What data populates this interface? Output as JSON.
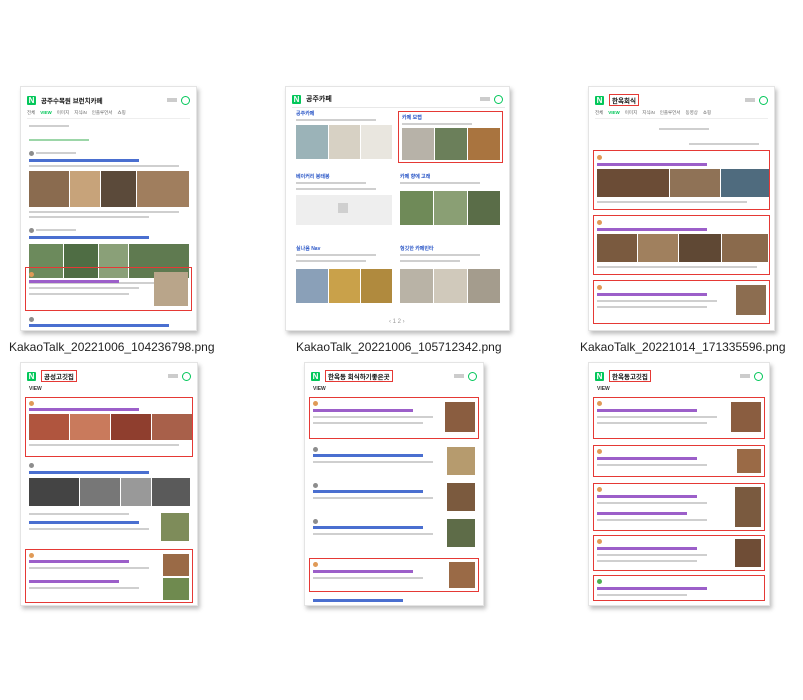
{
  "files": [
    {
      "name": "KakaoTalk_20221006_104236798.png",
      "query": "공주수목원 브런치카페"
    },
    {
      "name": "KakaoTalk_20221006_105712342.png",
      "query": "공주카페"
    },
    {
      "name": "KakaoTalk_20221014_171335596.png",
      "query": "한옥회식"
    },
    {
      "name": "",
      "query": "공성고깃집"
    },
    {
      "name": "",
      "query": "한옥동 회식하기좋은곳"
    },
    {
      "name": "",
      "query": "한옥동고깃집"
    }
  ],
  "thumb_ui": {
    "logo": "N",
    "view_label": "VIEW",
    "tabs": [
      "전체",
      "VIEW",
      "이미지",
      "지식iN",
      "인플루언서",
      "동영상",
      "쇼핑",
      "뉴스",
      "어학사전",
      "지도"
    ],
    "map_section": {
      "left_title": "공주카페",
      "right_title": "카페 모랩",
      "left_title_2": "베이커리 봉태봉",
      "right_title_2": "카페 향에 고래",
      "left_title_3": "실나움 Nav",
      "right_title_3": "헝깃한 카페빈타",
      "pager": "‹ 1 2 ›"
    }
  },
  "colors": {
    "highlight": "#e53935",
    "brand": "#03c75a",
    "link": "#2b57c7"
  }
}
